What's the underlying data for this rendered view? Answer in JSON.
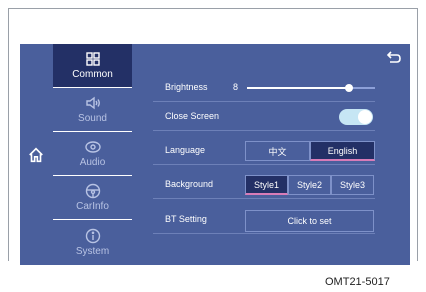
{
  "sidebar": {
    "items": [
      {
        "label": "Common",
        "icon": "grid-icon",
        "active": true
      },
      {
        "label": "Sound",
        "icon": "speaker-icon",
        "active": false
      },
      {
        "label": "Audio",
        "icon": "disc-icon",
        "active": false
      },
      {
        "label": "CarInfo",
        "icon": "steering-wheel-icon",
        "active": false
      },
      {
        "label": "System",
        "icon": "info-icon",
        "active": false
      }
    ]
  },
  "home": {
    "icon": "home-icon"
  },
  "back": {
    "icon": "back-arrow-icon"
  },
  "settings": {
    "brightness": {
      "label": "Brightness",
      "value": "8",
      "level": 0.8
    },
    "close_screen": {
      "label": "Close Screen",
      "on": true
    },
    "language": {
      "label": "Language",
      "options": [
        "中文",
        "English"
      ],
      "selected": "English"
    },
    "background": {
      "label": "Background",
      "options": [
        "Style1",
        "Style2",
        "Style3"
      ],
      "selected": "Style1"
    },
    "bt": {
      "label": "BT Setting",
      "button": "Click to set"
    }
  },
  "caption": "OMT21-5017",
  "colors": {
    "screen": "#4a5f9c",
    "active": "#233066",
    "accent": "#d87cb8"
  }
}
